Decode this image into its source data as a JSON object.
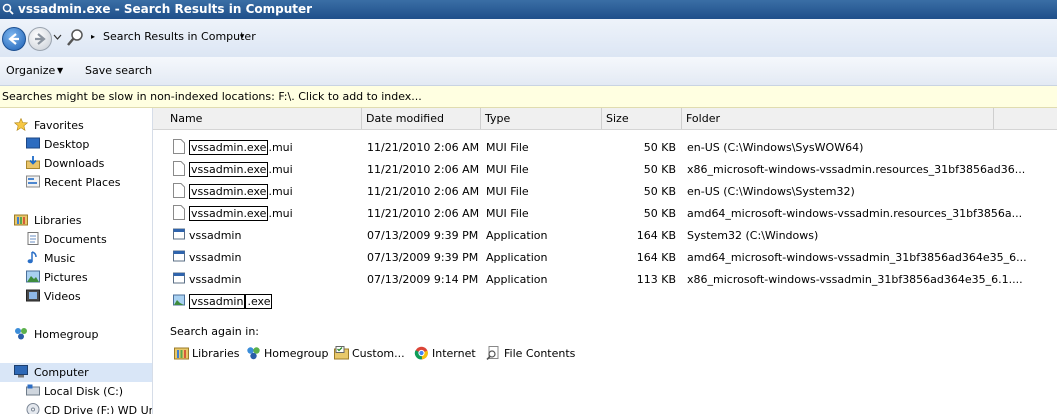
{
  "window": {
    "title": "vssadmin.exe - Search Results in Computer"
  },
  "address": {
    "breadcrumb": "Search Results in Computer"
  },
  "toolbar": {
    "organize": "Organize",
    "save_search": "Save search"
  },
  "infobar": {
    "text": "Searches might be slow in non-indexed locations: F:\\. Click to add to index..."
  },
  "nav": {
    "favorites": "Favorites",
    "desktop": "Desktop",
    "downloads": "Downloads",
    "recent_places": "Recent Places",
    "libraries": "Libraries",
    "documents": "Documents",
    "music": "Music",
    "pictures": "Pictures",
    "videos": "Videos",
    "homegroup": "Homegroup",
    "computer": "Computer",
    "local_disk": "Local Disk (C:)",
    "cd_drive": "CD Drive (F:) WD Unlo"
  },
  "columns": {
    "name": "Name",
    "date": "Date modified",
    "type": "Type",
    "size": "Size",
    "folder": "Folder"
  },
  "rows": [
    {
      "match": "vssadmin.exe",
      "rest": ".mui",
      "date": "11/21/2010 2:06 AM",
      "type": "MUI File",
      "size": "50 KB",
      "folder": "en-US (C:\\Windows\\SysWOW64)"
    },
    {
      "match": "vssadmin.exe",
      "rest": ".mui",
      "date": "11/21/2010 2:06 AM",
      "type": "MUI File",
      "size": "50 KB",
      "folder": "x86_microsoft-windows-vssadmin.resources_31bf3856ad36..."
    },
    {
      "match": "vssadmin.exe",
      "rest": ".mui",
      "date": "11/21/2010 2:06 AM",
      "type": "MUI File",
      "size": "50 KB",
      "folder": "en-US (C:\\Windows\\System32)"
    },
    {
      "match": "vssadmin.exe",
      "rest": ".mui",
      "date": "11/21/2010 2:06 AM",
      "type": "MUI File",
      "size": "50 KB",
      "folder": "amd64_microsoft-windows-vssadmin.resources_31bf3856a..."
    },
    {
      "name": "vssadmin",
      "date": "07/13/2009 9:39 PM",
      "type": "Application",
      "size": "164 KB",
      "folder": "System32 (C:\\Windows)"
    },
    {
      "name": "vssadmin",
      "date": "07/13/2009 9:39 PM",
      "type": "Application",
      "size": "164 KB",
      "folder": "amd64_microsoft-windows-vssadmin_31bf3856ad364e35_6..."
    },
    {
      "name": "vssadmin",
      "date": "07/13/2009 9:14 PM",
      "type": "Application",
      "size": "113 KB",
      "folder": "x86_microsoft-windows-vssadmin_31bf3856ad364e35_6.1...."
    }
  ],
  "last_row": {
    "a": "vssadmin",
    "b": ".exe"
  },
  "search_again": {
    "label": "Search again in:",
    "libraries": "Libraries",
    "homegroup": "Homegroup",
    "custom": "Custom...",
    "internet": "Internet",
    "file_contents": "File Contents"
  }
}
